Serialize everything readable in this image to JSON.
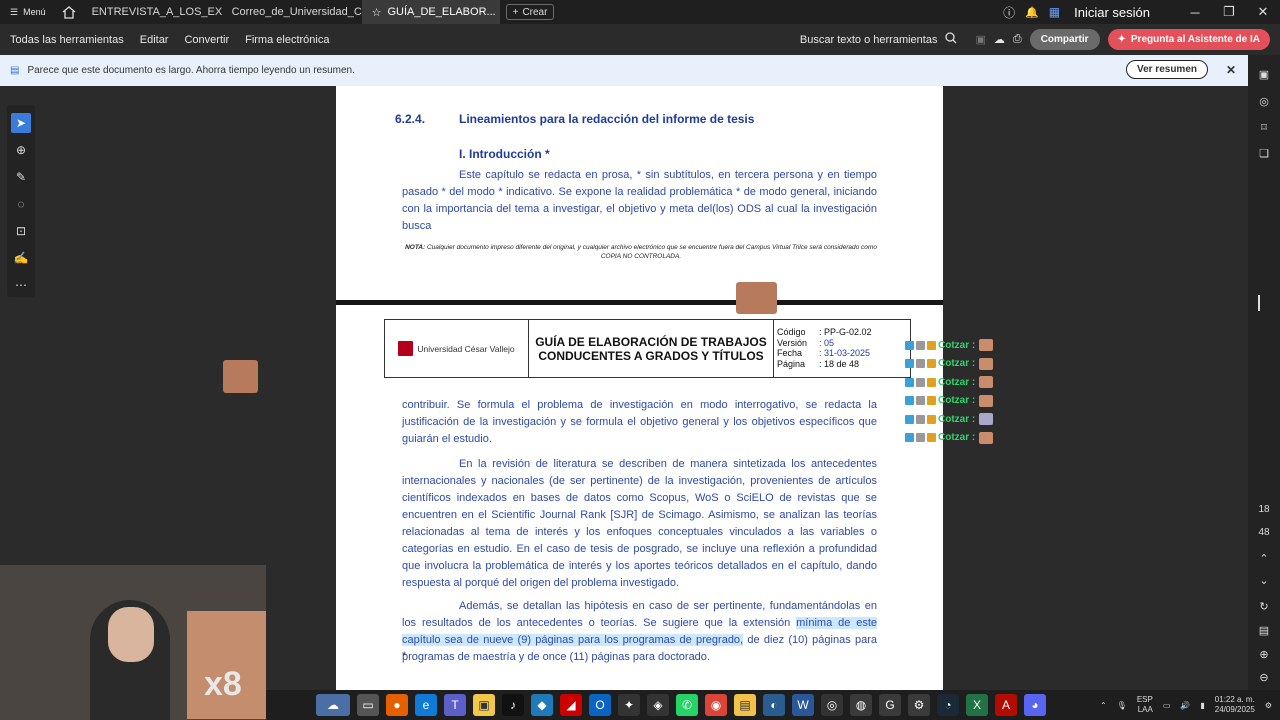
{
  "titlebar": {
    "menu_label": "Menú",
    "tabs": [
      {
        "label": "ENTREVISTA_A_LOS_EXP..."
      },
      {
        "label": "Correo_de_Universidad_C..."
      },
      {
        "label": "GUÍA_DE_ELABOR..."
      }
    ],
    "create_label": "Crear",
    "login_label": "Iniciar sesión"
  },
  "toolbar": {
    "items": [
      "Todas las herramientas",
      "Editar",
      "Convertir",
      "Firma electrónica"
    ],
    "search_label": "Buscar texto o herramientas",
    "share_label": "Compartir",
    "ai_label": "Pregunta al Asistente de IA"
  },
  "banner": {
    "text": "Parece que este documento es largo. Ahorra tiempo leyendo un resumen.",
    "button_label": "Ver resumen"
  },
  "right_rail": {
    "current_page": "18",
    "total_pages": "48"
  },
  "page_a": {
    "section_num": "6.2.4.",
    "section_title": "Lineamientos para la redacción del informe de tesis",
    "intro_title": "I. Introducción *",
    "paragraph": "Este capítulo se redacta en prosa, * sin subtítulos, en tercera persona y en tiempo pasado * del modo * indicativo. Se expone la realidad problemática * de modo general, iniciando con la importancia del tema a investigar, el objetivo y meta del(los) ODS al cual la investigación busca",
    "note_bold": "NOTA:",
    "note_text": "Cualquier documento impreso diferente del original, y cualquier archivo electrónico que se encuentre fuera del Campus Virtual Trilce será considerado como COPIA NO CONTROLADA."
  },
  "page_b": {
    "logo_text": "Universidad César Vallejo",
    "header_title": "GUÍA DE ELABORACIÓN DE TRABAJOS CONDUCENTES A GRADOS Y TÍTULOS",
    "meta": {
      "codigo_k": "Código",
      "codigo_v": ": PP-G-02.02",
      "version_k": "Versión",
      "version_v": ": 05",
      "fecha_k": "Fecha",
      "fecha_v": ": 31-03-2025",
      "pagina_k": "Página",
      "pagina_v": ": 18 de 48"
    },
    "p1": "contribuir. Se formula el problema de investigación en modo interrogativo, se redacta la justificación de la investigación y se formula el objetivo general y los objetivos específicos que guiarán el estudio.",
    "p2": "En la revisión de literatura se describen de manera sintetizada los antecedentes internacionales y nacionales (de ser pertinente) de la investigación, provenientes de artículos científicos indexados en bases de datos como Scopus, WoS o SciELO de revistas que se encuentren en el Scientific Journal Rank [SJR] de Scimago. Asimismo, se analizan las teorías relacionadas al tema de interés y los enfoques conceptuales vinculados a las variables o categorías en estudio. En el caso de tesis de posgrado, se incluye una reflexión a profundidad que involucra la problemática de interés y los aportes teóricos detallados en el capítulo, dando respuesta al porqué del origen del problema investigado.",
    "p3_a": "Además, se detallan las hipótesis en caso de ser pertinente, fundamentándolas en los resultados de los antecedentes o teorías. Se sugiere que la extensión ",
    "p3_hl": "mínima de este capítulo sea de nueve (9) páginas para los programas de pregrado,",
    "p3_b": " de diez (10) páginas para programas de maestría y de once (11) páginas para doctorado.",
    "star": "*"
  },
  "chat": {
    "rows": [
      "Cotzar :",
      "Cotzar :",
      "Cotzar :",
      "Cotzar :",
      "Cotzar :",
      "Cotzar :"
    ]
  },
  "webcam": {
    "overlay_text": "x8"
  },
  "tray": {
    "lang1": "ESP",
    "lang2": "LAA",
    "time": "01:22 a. m.",
    "date": "24/09/2025"
  },
  "colors": {
    "doc_blue": "#2e4aa8",
    "heading_blue": "#1f3b9c",
    "ai_button": "#e4505a",
    "chat_green": "#2fd36b",
    "banner_bg": "#e8f1fb"
  }
}
